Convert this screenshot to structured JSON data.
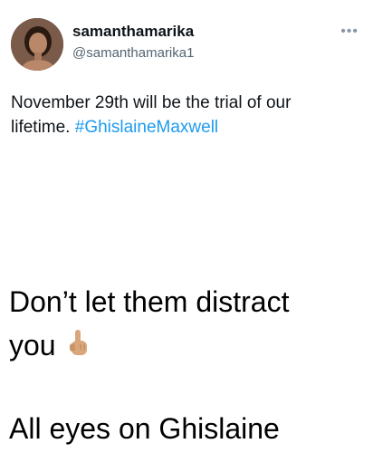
{
  "tweet": {
    "display_name": "samanthamarika",
    "handle": "@samanthamarika1",
    "more_icon": "more-dots-icon",
    "text_before": "November 29th will be the trial of our lifetime. ",
    "hashtag": "#GhislaineMaxwell"
  },
  "caption": {
    "line1": "Don’t let them distract",
    "line2": "you",
    "emoji_icon": "pointing-up-hand-icon",
    "line3": "All eyes on Ghislaine"
  },
  "colors": {
    "hashtag": "#1d9bf0",
    "handle": "#536471"
  }
}
